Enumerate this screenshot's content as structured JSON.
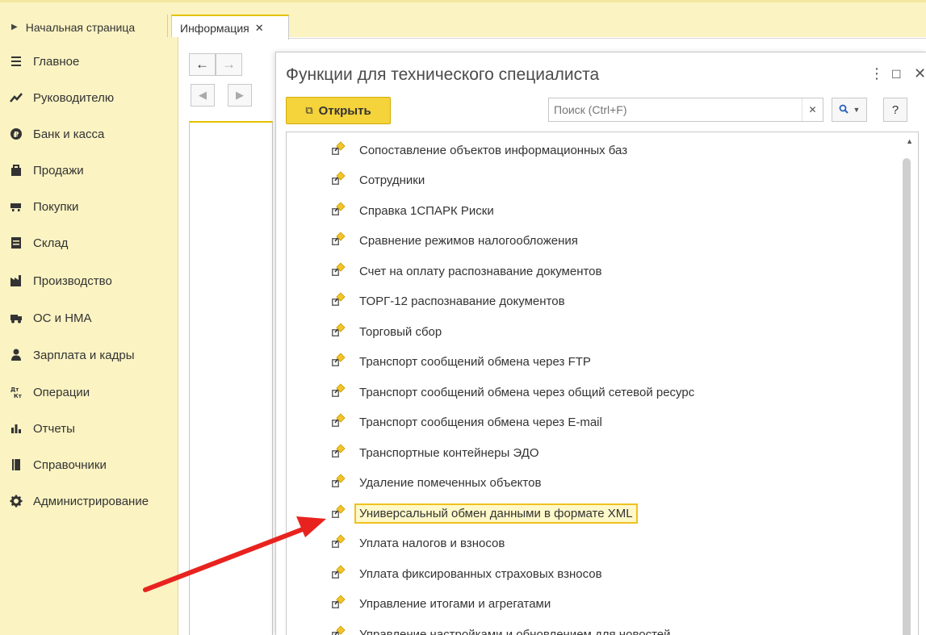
{
  "tabs": [
    {
      "label": "Начальная страница"
    },
    {
      "label": "Информация"
    }
  ],
  "sidebar": {
    "items": [
      {
        "label": "Главное",
        "icon": "menu-icon"
      },
      {
        "label": "Руководителю",
        "icon": "trend-icon"
      },
      {
        "label": "Банк и касса",
        "icon": "ruble-icon"
      },
      {
        "label": "Продажи",
        "icon": "bag-icon"
      },
      {
        "label": "Покупки",
        "icon": "cart-icon"
      },
      {
        "label": "Склад",
        "icon": "warehouse-icon"
      },
      {
        "label": "Производство",
        "icon": "factory-icon"
      },
      {
        "label": "ОС и НМА",
        "icon": "truck-icon"
      },
      {
        "label": "Зарплата и кадры",
        "icon": "person-icon"
      },
      {
        "label": "Операции",
        "icon": "debit-credit-icon"
      },
      {
        "label": "Отчеты",
        "icon": "bar-chart-icon"
      },
      {
        "label": "Справочники",
        "icon": "book-icon"
      },
      {
        "label": "Администрирование",
        "icon": "gear-icon"
      }
    ]
  },
  "dialog": {
    "title": "Функции для технического специалиста",
    "open_button": "Открыть",
    "search_placeholder": "Поиск (Ctrl+F)",
    "help_label": "?",
    "items": [
      {
        "label": "Сопоставление объектов информационных баз"
      },
      {
        "label": "Сотрудники"
      },
      {
        "label": "Справка 1СПАРК Риски"
      },
      {
        "label": "Сравнение режимов налогообложения"
      },
      {
        "label": "Счет на оплату распознавание документов"
      },
      {
        "label": "ТОРГ-12 распознавание документов"
      },
      {
        "label": "Торговый сбор"
      },
      {
        "label": "Транспорт сообщений обмена через FTP"
      },
      {
        "label": "Транспорт сообщений обмена через общий сетевой ресурс"
      },
      {
        "label": "Транспорт сообщения обмена через E-mail"
      },
      {
        "label": "Транспортные контейнеры ЭДО"
      },
      {
        "label": "Удаление помеченных объектов"
      },
      {
        "label": "Универсальный обмен данными в формате XML",
        "selected": true
      },
      {
        "label": "Уплата налогов и взносов"
      },
      {
        "label": "Уплата фиксированных страховых взносов"
      },
      {
        "label": "Управление итогами и агрегатами"
      },
      {
        "label": "Управление настройками и обновлением для новостей"
      }
    ]
  },
  "colors": {
    "sidebar_bg": "#fbf3c2",
    "accent": "#f5d33b",
    "selection_border": "#f0c020",
    "annotation_arrow": "#e8231f"
  }
}
